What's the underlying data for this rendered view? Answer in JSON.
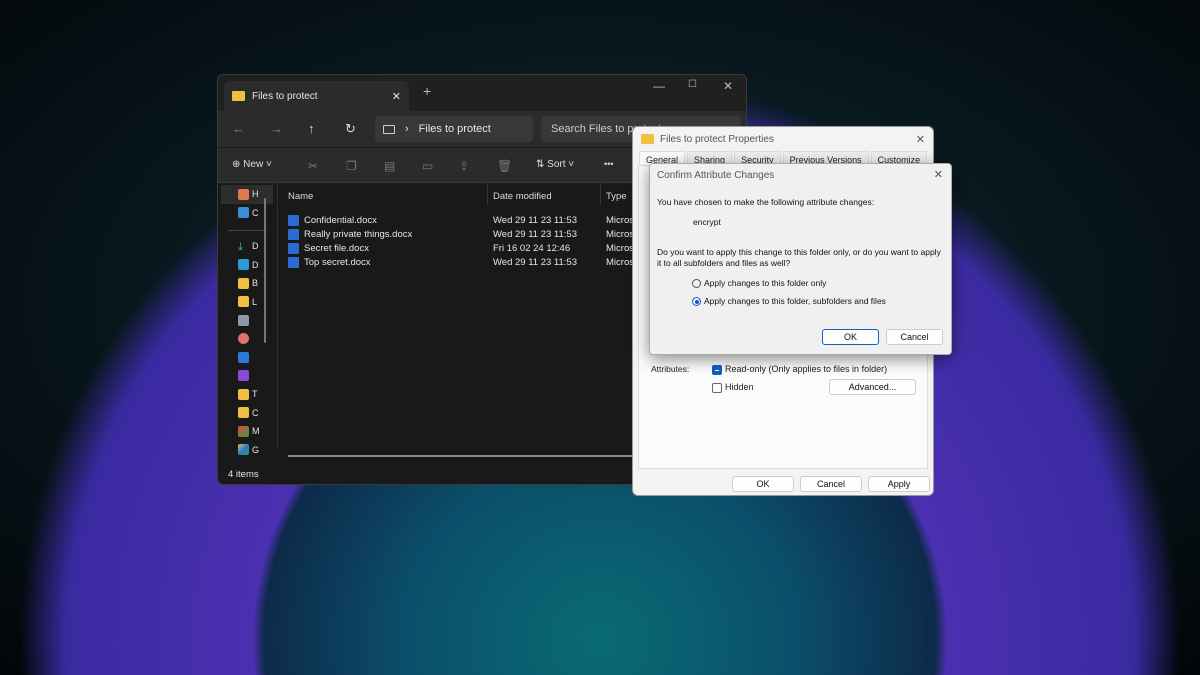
{
  "explorer": {
    "tab_title": "Files to protect",
    "new_tab": "+",
    "window_controls": [
      "—",
      "☐",
      "✕"
    ],
    "breadcrumb": "Files to protect",
    "search_placeholder": "Search Files to protect",
    "toolbar": {
      "new": "New",
      "sort": "Sort",
      "more": "•••"
    },
    "sidebar": [
      "H",
      "C",
      "D",
      "D",
      "B",
      "L",
      "",
      "",
      "",
      "",
      "T",
      "C",
      "M",
      "G"
    ],
    "columns": [
      "Name",
      "Date modified",
      "Type"
    ],
    "files": [
      {
        "name": "Confidential.docx",
        "date": "Wed 29 11 23 11:53",
        "type": "Micros"
      },
      {
        "name": "Really private things.docx",
        "date": "Wed 29 11 23 11:53",
        "type": "Micros"
      },
      {
        "name": "Secret file.docx",
        "date": "Fri 16 02 24 12:46",
        "type": "Micros"
      },
      {
        "name": "Top secret.docx",
        "date": "Wed 29 11 23 11:53",
        "type": "Micros"
      }
    ],
    "status": "4 items"
  },
  "properties": {
    "title": "Files to protect Properties",
    "tabs": [
      "General",
      "Sharing",
      "Security",
      "Previous Versions",
      "Customize"
    ],
    "attributes_label": "Attributes:",
    "readonly_label": "Read-only (Only applies to files in folder)",
    "hidden_label": "Hidden",
    "advanced": "Advanced...",
    "ok": "OK",
    "cancel": "Cancel",
    "apply": "Apply"
  },
  "confirm": {
    "title": "Confirm Attribute Changes",
    "intro": "You have chosen to make the following attribute changes:",
    "change": "encrypt",
    "question": "Do you want to apply this change to this folder only, or do you want to apply it to all subfolders and files as well?",
    "option1": "Apply changes to this folder only",
    "option2": "Apply changes to this folder, subfolders and files",
    "selected": "option2",
    "ok": "OK",
    "cancel": "Cancel"
  }
}
